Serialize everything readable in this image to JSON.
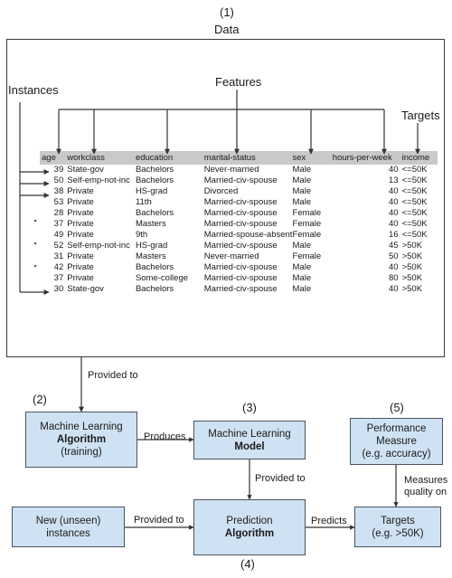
{
  "diagram": {
    "title_step": "(1)",
    "title": "Data",
    "annotations": {
      "instances": "Instances",
      "features": "Features",
      "targets": "Targets"
    }
  },
  "table": {
    "columns": [
      "age",
      "workclass",
      "education",
      "marital-status",
      "sex",
      "hours-per-week",
      "income"
    ],
    "rows": [
      [
        "39",
        "State-gov",
        "Bachelors",
        "Never-married",
        "Male",
        "40",
        "<=50K"
      ],
      [
        "50",
        "Self-emp-not-inc",
        "Bachelors",
        "Married-civ-spouse",
        "Male",
        "13",
        "<=50K"
      ],
      [
        "38",
        "Private",
        "HS-grad",
        "Divorced",
        "Male",
        "40",
        "<=50K"
      ],
      [
        "53",
        "Private",
        "11th",
        "Married-civ-spouse",
        "Male",
        "40",
        "<=50K"
      ],
      [
        "28",
        "Private",
        "Bachelors",
        "Married-civ-spouse",
        "Female",
        "40",
        "<=50K"
      ],
      [
        "37",
        "Private",
        "Masters",
        "Married-civ-spouse",
        "Female",
        "40",
        "<=50K"
      ],
      [
        "49",
        "Private",
        "9th",
        "Married-spouse-absent",
        "Female",
        "16",
        "<=50K"
      ],
      [
        "52",
        "Self-emp-not-inc",
        "HS-grad",
        "Married-civ-spouse",
        "Male",
        "45",
        ">50K"
      ],
      [
        "31",
        "Private",
        "Masters",
        "Never-married",
        "Female",
        "50",
        ">50K"
      ],
      [
        "42",
        "Private",
        "Bachelors",
        "Married-civ-spouse",
        "Male",
        "40",
        ">50K"
      ],
      [
        "37",
        "Private",
        "Some-college",
        "Married-civ-spouse",
        "Male",
        "80",
        ">50K"
      ],
      [
        "30",
        "State-gov",
        "Bachelors",
        "Married-civ-spouse",
        "Male",
        "40",
        ">50K"
      ]
    ]
  },
  "flow": {
    "steps": {
      "s2": "(2)",
      "s3": "(3)",
      "s4": "(4)",
      "s5": "(5)"
    },
    "boxes": {
      "ml_algorithm": {
        "line1": "Machine Learning",
        "line2": "Algorithm",
        "line3": "(training)"
      },
      "ml_model": {
        "line1": "Machine Learning",
        "line2": "Model"
      },
      "performance_measure": {
        "line1": "Performance",
        "line2": "Measure",
        "line3": "(e.g. accuracy)"
      },
      "new_instances": {
        "line1": "New (unseen)",
        "line2": "instances"
      },
      "prediction_algorithm": {
        "line1": "Prediction",
        "line2": "Algorithm"
      },
      "targets": {
        "line1": "Targets",
        "line2": "(e.g. >50K)"
      }
    },
    "edges": {
      "data_to_algorithm": "Provided to",
      "algorithm_to_model": "Produces",
      "model_to_prediction": "Provided to",
      "instances_to_prediction": "Provided to",
      "prediction_to_targets": "Predicts",
      "measure_to_targets_l1": "Measures",
      "measure_to_targets_l2": "quality on"
    }
  },
  "colors": {
    "box_fill": "#cfe2f3",
    "box_border": "#4a5561",
    "header_fill": "#c9c9c9",
    "line": "#333333"
  }
}
